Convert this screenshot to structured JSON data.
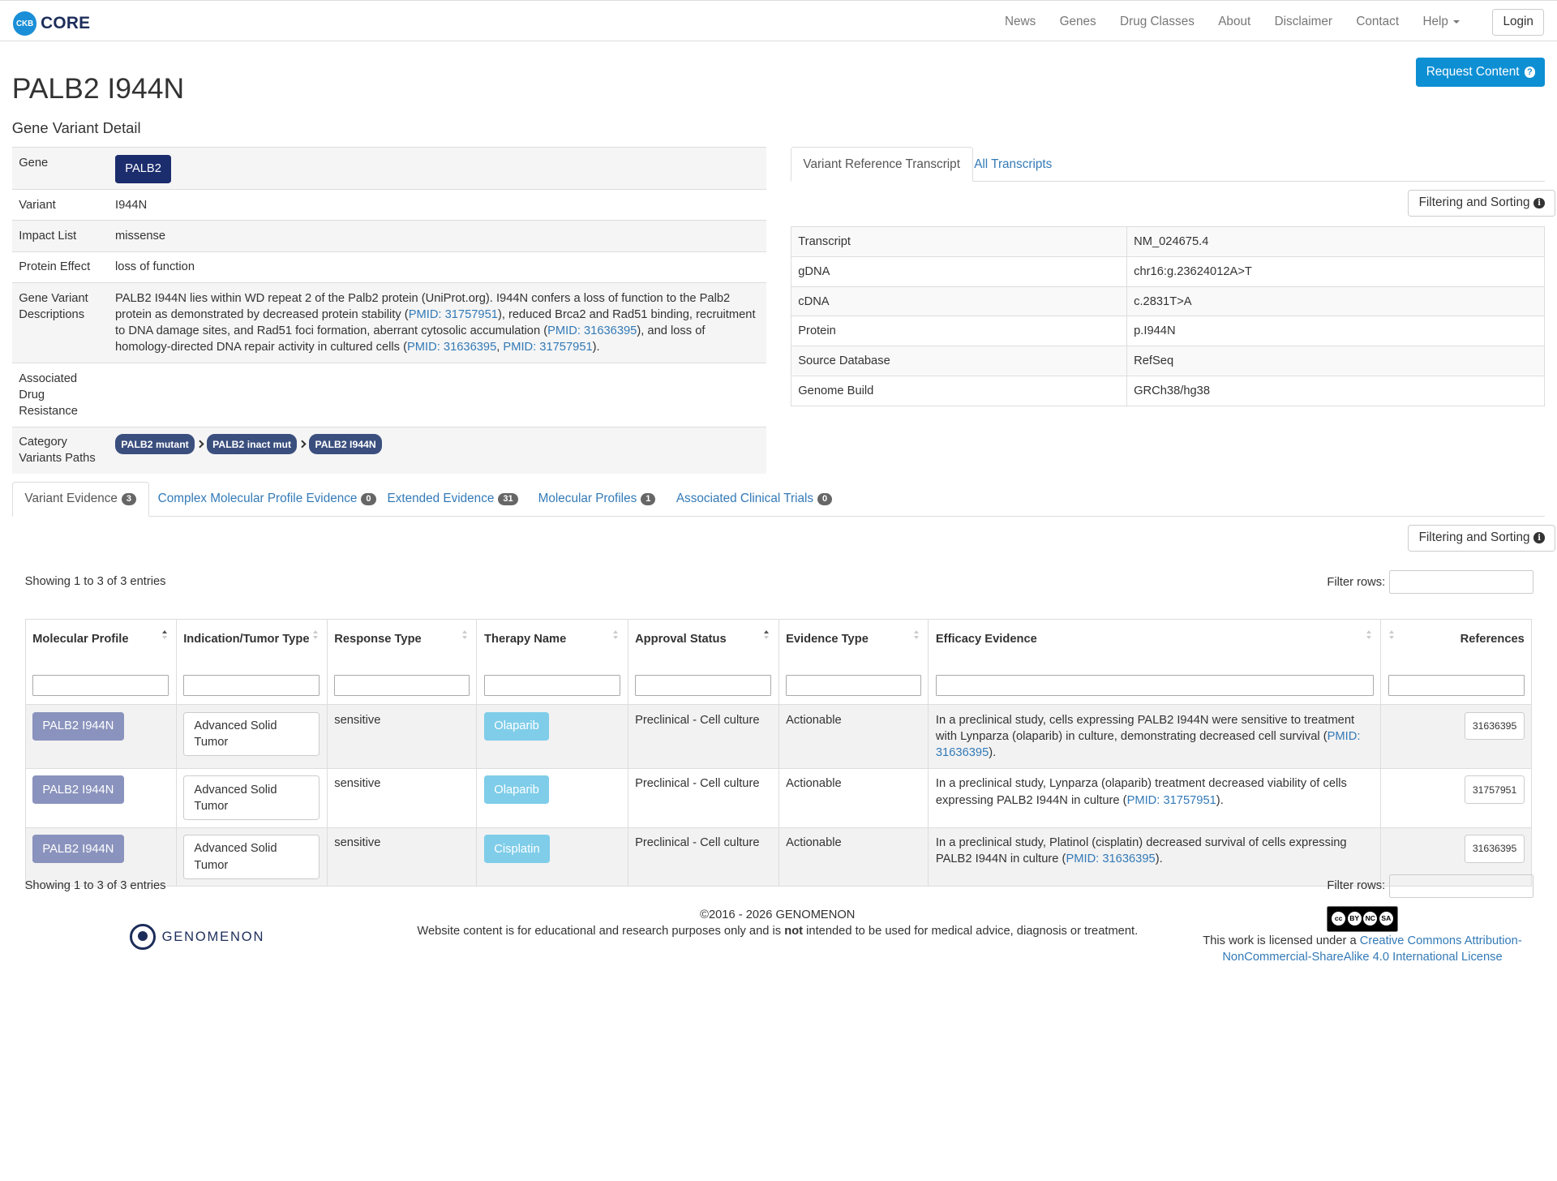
{
  "nav": {
    "brand_badge": "CKB",
    "brand_name": "CORE",
    "links": [
      "News",
      "Genes",
      "Drug Classes",
      "About",
      "Disclaimer",
      "Contact",
      "Help"
    ],
    "login": "Login"
  },
  "page": {
    "title": "PALB2 I944N",
    "subtitle": "Gene Variant Detail",
    "request_button": "Request Content"
  },
  "detail": {
    "gene_label": "Gene",
    "gene_value": "PALB2",
    "variant_label": "Variant",
    "variant_value": "I944N",
    "impact_label": "Impact List",
    "impact_value": "missense",
    "protein_effect_label": "Protein Effect",
    "protein_effect_value": "loss of function",
    "desc_label": "Gene Variant Descriptions",
    "desc_part1": "PALB2 I944N lies within WD repeat 2 of the Palb2 protein (UniProt.org). I944N confers a loss of function to the Palb2 protein as demonstrated by decreased protein stability (",
    "desc_link1": "PMID: 31757951",
    "desc_part2": "), reduced Brca2 and Rad51 binding, recruitment to DNA damage sites, and Rad51 foci formation, aberrant cytosolic accumulation (",
    "desc_link2": "PMID: 31636395",
    "desc_part3": "), and loss of homology-directed DNA repair activity in cultured cells (",
    "desc_link3": "PMID: 31636395",
    "desc_sep": ", ",
    "desc_link4": "PMID: 31757951",
    "desc_end": ").",
    "assoc_label": "Associated Drug Resistance",
    "category_label": "Category Variants Paths",
    "paths": [
      "PALB2 mutant",
      "PALB2 inact mut",
      "PALB2 I944N"
    ]
  },
  "transcript": {
    "tabs": [
      "Variant Reference Transcript",
      "All Transcripts"
    ],
    "filter_button": "Filtering and Sorting",
    "rows": [
      {
        "label": "Transcript",
        "value": "NM_024675.4"
      },
      {
        "label": "gDNA",
        "value": "chr16:g.23624012A>T"
      },
      {
        "label": "cDNA",
        "value": "c.2831T>A"
      },
      {
        "label": "Protein",
        "value": "p.I944N"
      },
      {
        "label": "Source Database",
        "value": "RefSeq"
      },
      {
        "label": "Genome Build",
        "value": "GRCh38/hg38"
      }
    ]
  },
  "evidence_tabs": [
    {
      "label": "Variant Evidence",
      "count": "3"
    },
    {
      "label": "Complex Molecular Profile Evidence",
      "count": "0"
    },
    {
      "label": "Extended Evidence",
      "count": "31"
    },
    {
      "label": "Molecular Profiles",
      "count": "1"
    },
    {
      "label": "Associated Clinical Trials",
      "count": "0"
    }
  ],
  "evidence": {
    "filter_button": "Filtering and Sorting",
    "showing": "Showing 1 to 3 of 3 entries",
    "filter_rows_label": "Filter rows:",
    "columns": [
      "Molecular Profile",
      "Indication/Tumor Type",
      "Response Type",
      "Therapy Name",
      "Approval Status",
      "Evidence Type",
      "Efficacy Evidence",
      "References"
    ],
    "rows": [
      {
        "profile": "PALB2 I944N",
        "indication": "Advanced Solid Tumor",
        "response": "sensitive",
        "therapy": "Olaparib",
        "approval": "Preclinical - Cell culture",
        "evidence_type": "Actionable",
        "efficacy_text": "In a preclinical study, cells expressing PALB2 I944N were sensitive to treatment with Lynparza (olaparib) in culture, demonstrating decreased cell survival (",
        "efficacy_link": "PMID: 31636395",
        "efficacy_end": ").",
        "reference": "31636395"
      },
      {
        "profile": "PALB2 I944N",
        "indication": "Advanced Solid Tumor",
        "response": "sensitive",
        "therapy": "Olaparib",
        "approval": "Preclinical - Cell culture",
        "evidence_type": "Actionable",
        "efficacy_text": "In a preclinical study, Lynparza (olaparib) treatment decreased viability of cells expressing PALB2 I944N in culture (",
        "efficacy_link": "PMID: 31757951",
        "efficacy_end": ").",
        "reference": "31757951"
      },
      {
        "profile": "PALB2 I944N",
        "indication": "Advanced Solid Tumor",
        "response": "sensitive",
        "therapy": "Cisplatin",
        "approval": "Preclinical - Cell culture",
        "evidence_type": "Actionable",
        "efficacy_text": "In a preclinical study, Platinol (cisplatin) decreased survival of cells expressing PALB2 I944N in culture (",
        "efficacy_link": "PMID: 31636395",
        "efficacy_end": ").",
        "reference": "31636395"
      }
    ]
  },
  "footer": {
    "logo_text": "GENOMENON",
    "copyright": "©2016 - 2026 GENOMENON",
    "disclaimer_a": "Website content is for educational and research purposes only and is ",
    "disclaimer_bold": "not",
    "disclaimer_b": " intended to be used for medical advice, diagnosis or treatment.",
    "license_prefix": "This work is licensed under a ",
    "license_link": "Creative Commons Attribution-NonCommercial-ShareAlike 4.0 International License",
    "cc_glyphs": [
      "cc",
      "BY",
      "NC",
      "SA"
    ]
  },
  "colors": {
    "accent": "#0d8fd4",
    "gene_button": "#1c2d6e",
    "profile_button": "#8a93bd",
    "therapy_button": "#7fcde9",
    "link": "#337ab7"
  }
}
